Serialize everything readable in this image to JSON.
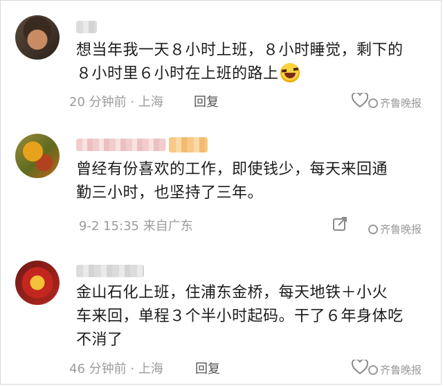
{
  "comments": [
    {
      "text_line1": "想当年我一天８小时上班，８小时睡觉，剩下的",
      "text_line2": "８小时里６小时在上班的路上",
      "emoji": "laughing-crying-emoji",
      "time": "20 分钟前 · 上海",
      "reply": "回复",
      "watermark": "齐鲁晚报"
    },
    {
      "text_line1": "曾经有份喜欢的工作，即使钱少，每天来回通",
      "text_line2": "勤三小时，也坚持了三年。",
      "time": "9-2 15:35  来自广东",
      "watermark": "齐鲁晚报"
    },
    {
      "text_line1": "金山石化上班，住浦东金桥，每天地铁＋小火",
      "text_line2": "车来回，单程３个半小时起码。干了６年身体吃",
      "text_line3": "不消了",
      "time": "46 分钟前 · 上海",
      "reply": "回复",
      "watermark": "齐鲁晚报"
    }
  ],
  "colors": {
    "text": "#1b1b1b",
    "meta": "#9b9b9b",
    "background": "#ffffff"
  },
  "icons": [
    "heart-icon",
    "share-icon",
    "more-icon",
    "wechat-logo-icon"
  ]
}
